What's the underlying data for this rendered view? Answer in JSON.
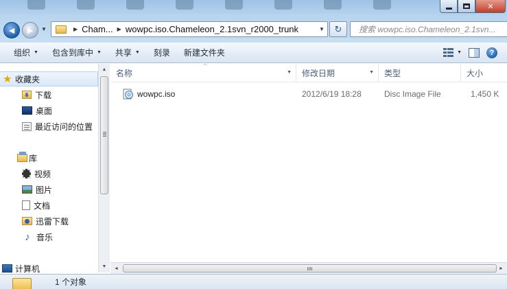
{
  "window": {
    "controls": {
      "minimize": "",
      "maximize": "",
      "close": "✕"
    }
  },
  "navigation": {
    "back_glyph": "◄",
    "forward_glyph": "►",
    "breadcrumbs": [
      "Cham...",
      "wowpc.iso.Chameleon_2.1svn_r2000_trunk"
    ],
    "refresh_glyph": "↻",
    "search_placeholder": "搜索 wowpc.iso.Chameleon_2.1svn..."
  },
  "toolbar": {
    "organize": "组织",
    "include_in_library": "包含到库中",
    "share": "共享",
    "burn": "刻录",
    "new_folder": "新建文件夹",
    "help": "?"
  },
  "sidebar": {
    "favorites": {
      "label": "收藏夹",
      "items": [
        {
          "label": "下载",
          "icon": "download-folder-icon"
        },
        {
          "label": "桌面",
          "icon": "desktop-icon"
        },
        {
          "label": "最近访问的位置",
          "icon": "recent-places-icon"
        }
      ]
    },
    "libraries": {
      "label": "库",
      "items": [
        {
          "label": "视频",
          "icon": "video-icon"
        },
        {
          "label": "图片",
          "icon": "pictures-icon"
        },
        {
          "label": "文档",
          "icon": "documents-icon"
        },
        {
          "label": "迅雷下载",
          "icon": "xunlei-download-icon"
        },
        {
          "label": "音乐",
          "icon": "music-icon"
        }
      ]
    },
    "computer": {
      "label": "计算机"
    }
  },
  "file_list": {
    "columns": [
      "名称",
      "修改日期",
      "类型",
      "大小"
    ],
    "rows": [
      {
        "name": "wowpc.iso",
        "modified": "2012/6/19 18:28",
        "type": "Disc Image File",
        "size": "1,450 K",
        "icon": "disc-image-icon"
      }
    ]
  },
  "status": {
    "item_count": "1 个对象"
  },
  "colors": {
    "titlebar": "#b9d5ef",
    "toolbar": "#e6eef7",
    "selection": "#d9e9fa",
    "header_text": "#4c607a"
  }
}
